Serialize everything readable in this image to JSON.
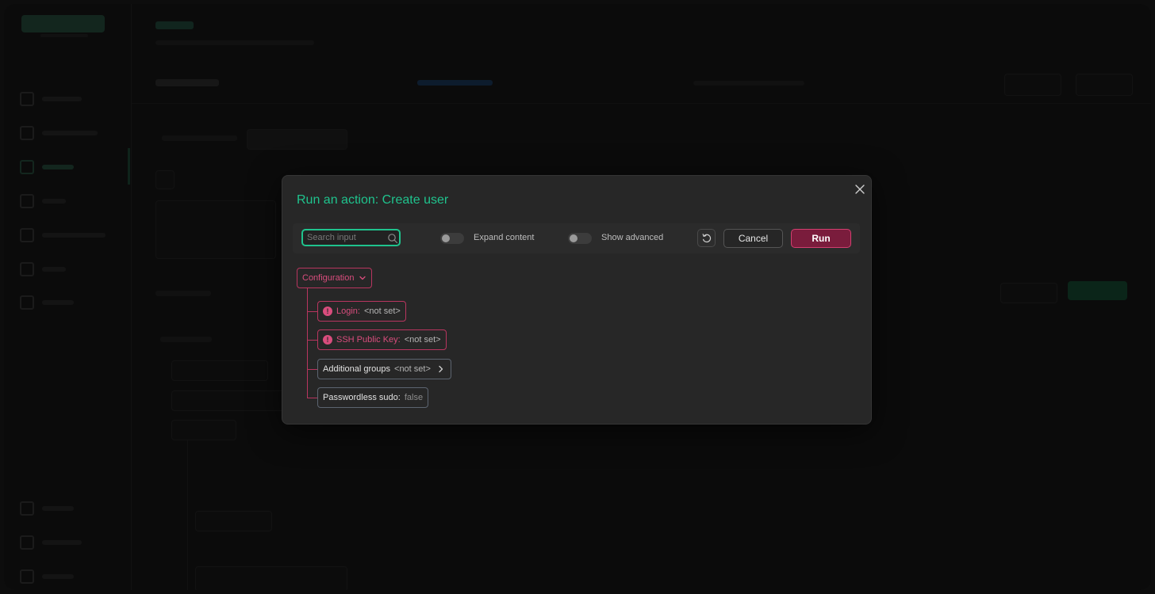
{
  "modal": {
    "title": "Run an action: Create user",
    "search": {
      "placeholder": "Search input",
      "value": ""
    },
    "expand_toggle": {
      "label": "Expand content",
      "on": false
    },
    "advanced_toggle": {
      "label": "Show advanced",
      "on": false
    },
    "cancel_label": "Cancel",
    "run_label": "Run",
    "colors": {
      "accent": "#1fc38d",
      "error": "#d94d7d",
      "run": "#7a1c3c"
    }
  },
  "tree": {
    "root": {
      "label": "Configuration",
      "expanded": true,
      "status": "error"
    },
    "items": [
      {
        "label": "Login:",
        "value": "<not set>",
        "status": "error"
      },
      {
        "label": "SSH Public Key:",
        "value": "<not set>",
        "status": "error"
      },
      {
        "label": "Additional groups",
        "value": "<not set>",
        "status": "ok"
      },
      {
        "label": "Passwordless sudo:",
        "value": "false",
        "status": "ok"
      }
    ]
  }
}
